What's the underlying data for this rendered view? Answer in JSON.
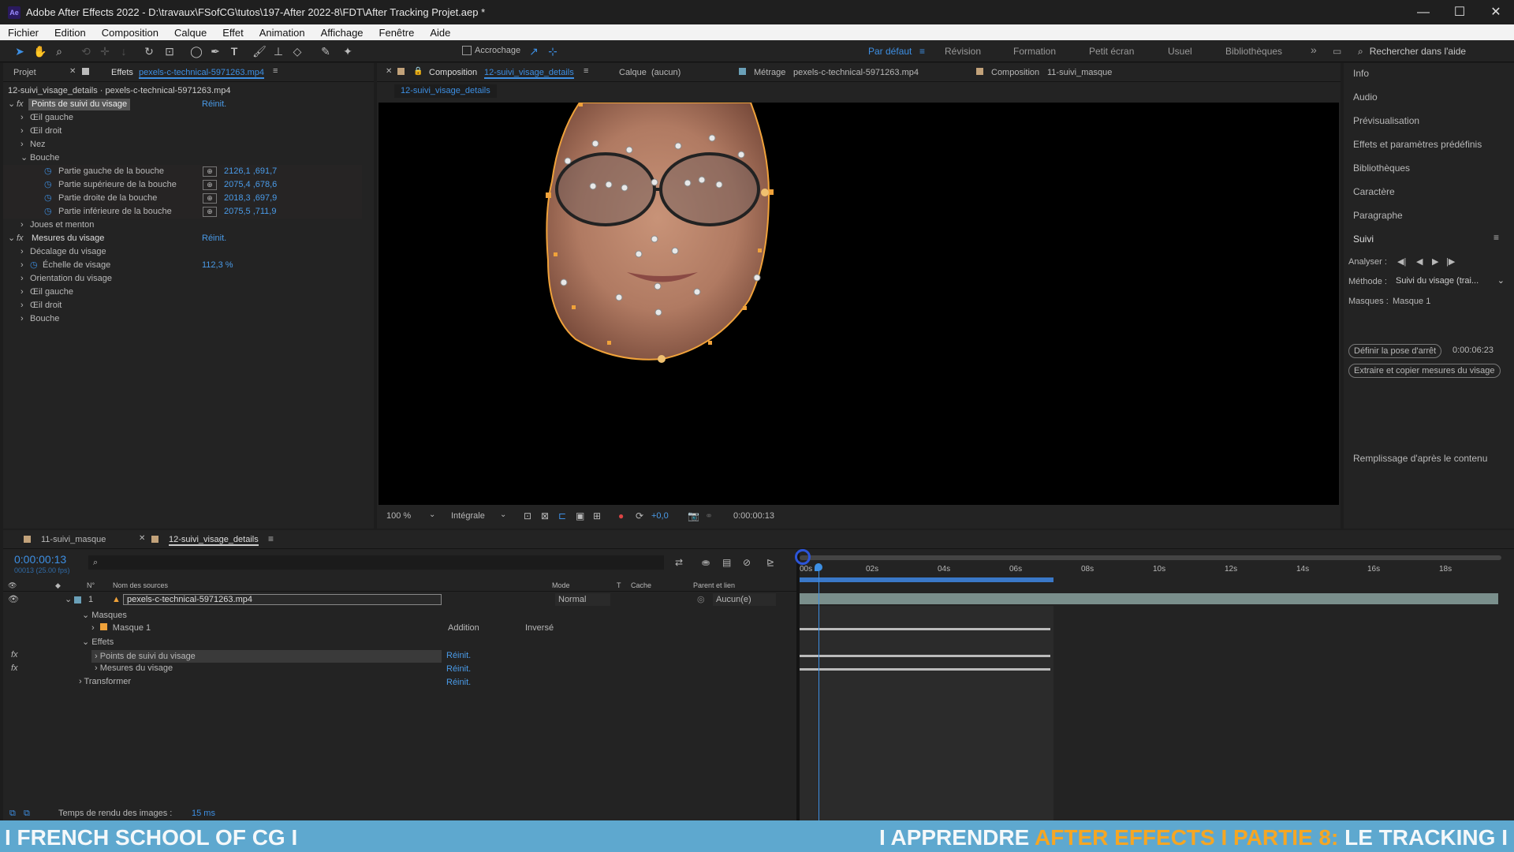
{
  "window": {
    "app_icon": "Ae",
    "title": "Adobe After Effects 2022 - D:\\travaux\\FSofCG\\tutos\\197-After 2022-8\\FDT\\After Tracking Projet.aep *",
    "minimize": "—",
    "maximize": "☐",
    "close": "✕"
  },
  "menu": [
    "Fichier",
    "Edition",
    "Composition",
    "Calque",
    "Effet",
    "Animation",
    "Affichage",
    "Fenêtre",
    "Aide"
  ],
  "toolbar": {
    "snap_label": "Accrochage",
    "workspaces": [
      "Par défaut",
      "Révision",
      "Formation",
      "Petit écran",
      "Usuel",
      "Bibliothèques"
    ],
    "more": "»",
    "search_placeholder": "Rechercher dans l'aide"
  },
  "effects_panel": {
    "tab_project": "Projet",
    "tab_effects": "Effets",
    "tab_effects_source": "pexels-c-technical-5971263.mp4",
    "breadcrumb": "12-suivi_visage_details · pexels-c-technical-5971263.mp4",
    "fx_badge": "fx",
    "reset": "Réinit.",
    "face_points": {
      "title": "Points de suivi du visage",
      "left_eye": "Œil gauche",
      "right_eye": "Œil droit",
      "nose": "Nez",
      "mouth": "Bouche",
      "mouth_props": [
        {
          "label": "Partie gauche de la bouche",
          "value": "2126,1 ,691,7"
        },
        {
          "label": "Partie supérieure de la bouche",
          "value": "2075,4 ,678,6"
        },
        {
          "label": "Partie droite de la bouche",
          "value": "2018,3 ,697,9"
        },
        {
          "label": "Partie inférieure de la bouche",
          "value": "2075,5 ,711,9"
        }
      ],
      "cheeks": "Joues et menton"
    },
    "face_measures": {
      "title": "Mesures du visage",
      "offset": "Décalage du visage",
      "scale_label": "Échelle de visage",
      "scale_value": "112,3 %",
      "orientation": "Orientation du visage",
      "left_eye": "Œil gauche",
      "right_eye": "Œil droit",
      "mouth": "Bouche"
    }
  },
  "comp_panel": {
    "tab_label": "Composition",
    "tab_comp_name": "12-suivi_visage_details",
    "layer_label": "Calque",
    "layer_value": "(aucun)",
    "footage_label": "Métrage",
    "footage_value": "pexels-c-technical-5971263.mp4",
    "comp2_label": "Composition",
    "comp2_value": "11-suivi_masque",
    "breadcrumb_tab": "12-suivi_visage_details",
    "zoom": "100 %",
    "resolution": "Intégrale",
    "exposure": "+0,0",
    "timecode": "0:00:00:13"
  },
  "right_panel": {
    "items": [
      "Info",
      "Audio",
      "Prévisualisation",
      "Effets et paramètres prédéfinis",
      "Bibliothèques",
      "Caractère",
      "Paragraphe"
    ],
    "tracking_title": "Suivi",
    "analyze_label": "Analyser :",
    "method_label": "Méthode :",
    "method_value": "Suivi du visage (trai...",
    "masks_label": "Masques :",
    "masks_value": "Masque 1",
    "set_rest_pose": "Définir la pose d'arrêt",
    "rest_time": "0:00:06:23",
    "extract_button": "Extraire et copier mesures du visage",
    "content_fill": "Remplissage d'après le contenu"
  },
  "timeline": {
    "tab1": "11-suivi_masque",
    "tab2": "12-suivi_visage_details",
    "current_time": "0:00:00:13",
    "frame_info": "00013 (25.00 fps)",
    "ruler": [
      "00s",
      "02s",
      "04s",
      "06s",
      "08s",
      "10s",
      "12s",
      "14s",
      "16s",
      "18s"
    ],
    "columns": {
      "num": "N°",
      "source": "Nom des sources",
      "mode": "Mode",
      "t": "T",
      "cache": "Cache",
      "parent": "Parent et lien"
    },
    "layer_num": "1",
    "layer_name": "pexels-c-technical-5971263.mp4",
    "layer_mode": "Normal",
    "layer_parent": "Aucun(e)",
    "masks": "Masques",
    "mask1": "Masque 1",
    "mask_mode": "Addition",
    "inverted": "Inversé",
    "effects": "Effets",
    "eff1": "Points de suivi du visage",
    "eff2": "Mesures du visage",
    "transform": "Transformer",
    "reset": "Réinit.",
    "render_label": "Temps de rendu des images :",
    "render_value": "15 ms"
  },
  "banner": {
    "left": "I FRENCH SCHOOL OF CG I",
    "right_a": "I APPRENDRE ",
    "right_b": "AFTER EFFECTS",
    "right_c": " I PARTIE 8: ",
    "right_d": "LE TRACKING I"
  },
  "colors": {
    "accent": "#3d8fe3",
    "mask": "#f0a23a",
    "banner": "#5ea8cf",
    "banner_highlight": "#f5a623"
  }
}
